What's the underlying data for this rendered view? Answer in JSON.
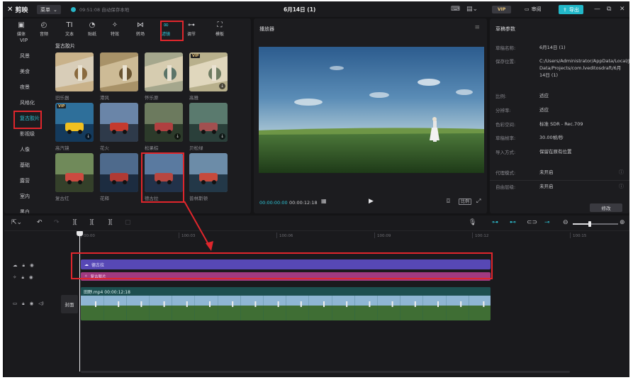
{
  "titlebar": {
    "logo": "剪映",
    "menu": "菜单",
    "save_status": "09:51:08 自动保存本地",
    "doc_title": "6月14日 (1)",
    "vip": "VIP",
    "review": "审阅",
    "export": "导出"
  },
  "tools": [
    {
      "icon": "▣",
      "label": "媒体"
    },
    {
      "icon": "◴",
      "label": "音频"
    },
    {
      "icon": "TI",
      "label": "文本"
    },
    {
      "icon": "◔",
      "label": "贴纸"
    },
    {
      "icon": "✧",
      "label": "特效"
    },
    {
      "icon": "⋈",
      "label": "转场"
    },
    {
      "icon": "∞",
      "label": "滤镜"
    },
    {
      "icon": "⊶",
      "label": "调节"
    },
    {
      "icon": "⛶",
      "label": "模板"
    }
  ],
  "categories": [
    "VIP",
    "风景",
    "美食",
    "夜景",
    "风格化",
    "复古胶片",
    "影视级",
    "人像",
    "基础",
    "露营",
    "室内",
    "黑白"
  ],
  "filters_section_title": "复古胶片",
  "filters": [
    {
      "label": "旧乐器",
      "vip": false,
      "dl": false
    },
    {
      "label": "港风",
      "vip": false,
      "dl": false
    },
    {
      "label": "怀乐原",
      "vip": false,
      "dl": false
    },
    {
      "label": "高雅",
      "vip": true,
      "dl": true
    },
    {
      "label": "高汽镜",
      "vip": true,
      "dl": true
    },
    {
      "label": "花火",
      "vip": false,
      "dl": false
    },
    {
      "label": "松果棕",
      "vip": false,
      "dl": true
    },
    {
      "label": "贝松绿",
      "vip": false,
      "dl": true
    },
    {
      "label": "复古红",
      "vip": false,
      "dl": false
    },
    {
      "label": "花释",
      "vip": false,
      "dl": false
    },
    {
      "label": "德古拉",
      "vip": false,
      "dl": false
    },
    {
      "label": "普林斯顿",
      "vip": false,
      "dl": false
    }
  ],
  "player": {
    "title": "播放器",
    "current_time": "00:00:00:00",
    "total_time": "00:00:12:18",
    "ratio": "比例"
  },
  "params": {
    "title": "草稿参数",
    "rows": [
      {
        "label": "草稿名称:",
        "value": "6月14日 (1)"
      },
      {
        "label": "保存位置:",
        "value": "C:/Users/Administrator/AppData/Local/JianyingPro/User Data/Projects/com.lveditosdraft/6月14日 (1)"
      },
      {
        "label": "比例:",
        "value": "适应"
      },
      {
        "label": "分辨率:",
        "value": "适应"
      },
      {
        "label": "色彩空间:",
        "value": "标准 SDR - Rec.709"
      },
      {
        "label": "草稿帧率:",
        "value": "30.00帧/秒"
      },
      {
        "label": "导入方式:",
        "value": "保留在原有位置"
      },
      {
        "label": "代理模式:",
        "value": "未开启"
      },
      {
        "label": "自由层级:",
        "value": "未开启"
      }
    ],
    "modify": "修改"
  },
  "timeline": {
    "ruler": [
      "00:00",
      "100:03",
      "100:06",
      "100:09",
      "100:12",
      "100:15"
    ],
    "filter_clip_label": "德古拉",
    "effect_clip_label": "复古胶片",
    "video_clip_label": "田野.mp4  00:00:12:18",
    "cover": "封面"
  }
}
